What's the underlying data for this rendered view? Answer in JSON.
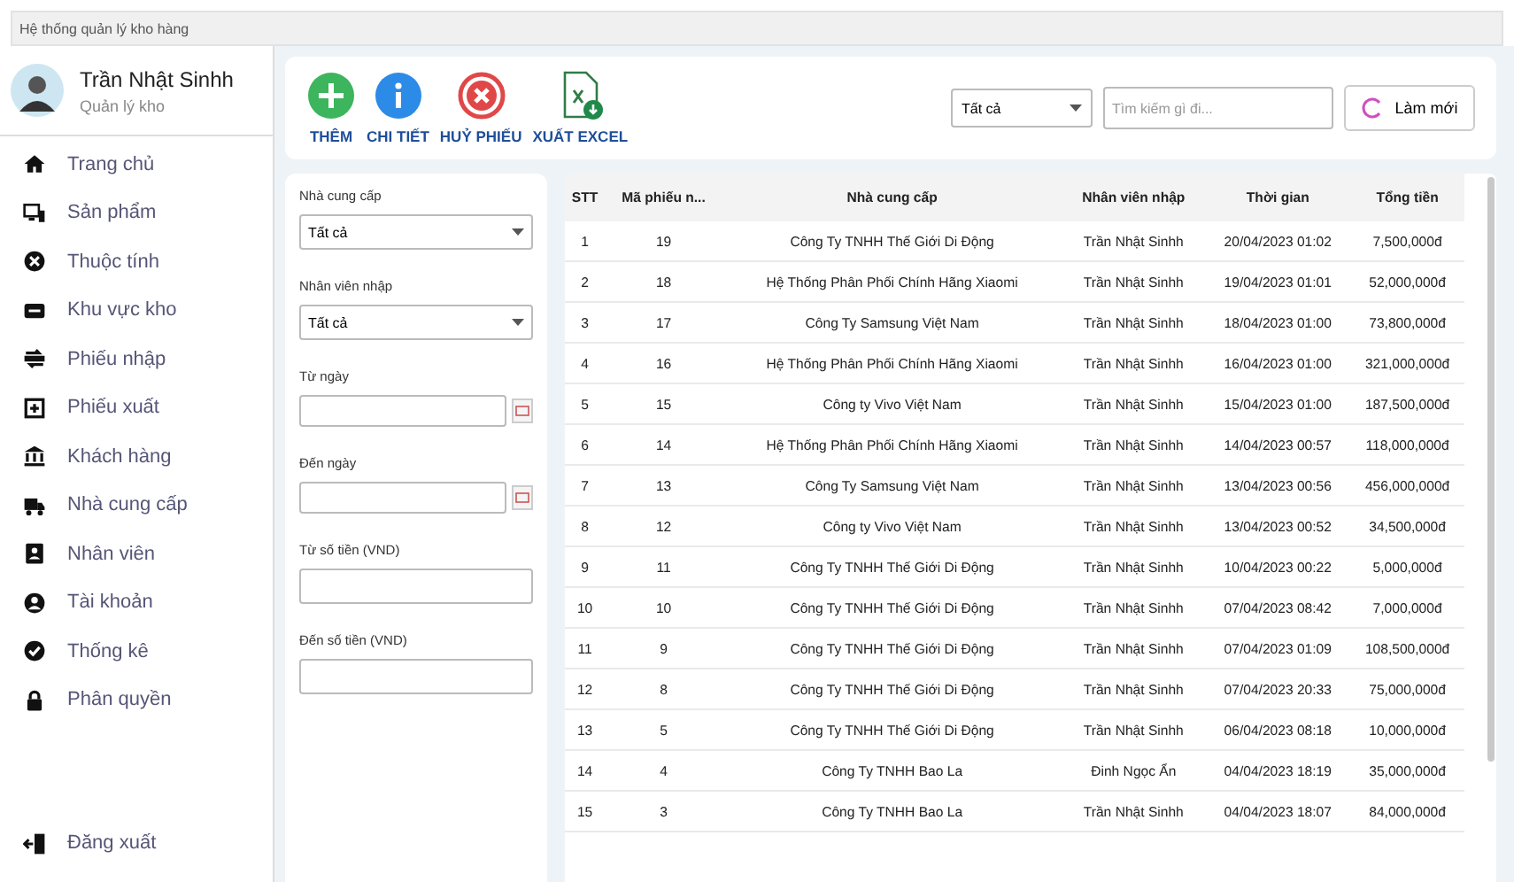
{
  "window": {
    "title": "Hệ thống quản lý kho hàng"
  },
  "user": {
    "name": "Trần Nhật Sinhh",
    "role": "Quản lý kho"
  },
  "sidebar": {
    "items": [
      {
        "label": "Trang chủ",
        "selected": false
      },
      {
        "label": "Sản phẩm",
        "selected": false
      },
      {
        "label": "Thuộc tính",
        "selected": false
      },
      {
        "label": "Khu vực kho",
        "selected": false
      },
      {
        "label": "Phiếu nhập",
        "selected": false
      },
      {
        "label": "Phiếu xuất",
        "selected": false
      },
      {
        "label": "Khách hàng",
        "selected": false
      },
      {
        "label": "Nhà cung cấp",
        "selected": false
      },
      {
        "label": "Nhân viên",
        "selected": false
      },
      {
        "label": "Tài khoản",
        "selected": false
      },
      {
        "label": "Thống kê",
        "selected": false
      },
      {
        "label": "Phân quyền",
        "selected": false
      }
    ],
    "logout": "Đăng xuất"
  },
  "toolbar": {
    "actions": [
      {
        "label": "THÊM",
        "kind": "add"
      },
      {
        "label": "CHI TIẾT",
        "kind": "info"
      },
      {
        "label": "HUỶ PHIẾU",
        "kind": "cancel"
      },
      {
        "label": "XUẤT EXCEL",
        "kind": "excel"
      }
    ],
    "filter_select": "Tất cả",
    "search": {
      "placeholder": "Tìm kiếm gì đi..."
    },
    "refresh": "Làm mới"
  },
  "filters": [
    {
      "label": "Nhà cung cấp",
      "kind": "select",
      "value": "Tất cả"
    },
    {
      "label": "Nhân viên nhập",
      "kind": "select",
      "value": "Tất cả"
    },
    {
      "label": "Từ ngày",
      "kind": "date"
    },
    {
      "label": "Đến ngày",
      "kind": "date"
    },
    {
      "label": "Từ số tiền (VND)",
      "kind": "text"
    },
    {
      "label": "Đến số tiền (VND)",
      "kind": "text"
    }
  ],
  "table": {
    "columns": [
      "STT",
      "Mã phiếu n...",
      "Nhà cung cấp",
      "Nhân viên nhập",
      "Thời gian",
      "Tổng tiền"
    ],
    "rows": [
      [
        "1",
        "19",
        "Công Ty TNHH Thế Giới Di Động",
        "Trần Nhật Sinhh",
        "20/04/2023 01:02",
        "7,500,000đ"
      ],
      [
        "2",
        "18",
        "Hệ Thống Phân Phối Chính Hãng Xiaomi",
        "Trần Nhật Sinhh",
        "19/04/2023 01:01",
        "52,000,000đ"
      ],
      [
        "3",
        "17",
        "Công Ty Samsung Việt Nam",
        "Trần Nhật Sinhh",
        "18/04/2023 01:00",
        "73,800,000đ"
      ],
      [
        "4",
        "16",
        "Hệ Thống Phân Phối Chính Hãng Xiaomi",
        "Trần Nhật Sinhh",
        "16/04/2023 01:00",
        "321,000,000đ"
      ],
      [
        "5",
        "15",
        "Công ty Vivo Việt Nam",
        "Trần Nhật Sinhh",
        "15/04/2023 01:00",
        "187,500,000đ"
      ],
      [
        "6",
        "14",
        "Hệ Thống Phân Phối Chính Hãng Xiaomi",
        "Trần Nhật Sinhh",
        "14/04/2023 00:57",
        "118,000,000đ"
      ],
      [
        "7",
        "13",
        "Công Ty Samsung Việt Nam",
        "Trần Nhật Sinhh",
        "13/04/2023 00:56",
        "456,000,000đ"
      ],
      [
        "8",
        "12",
        "Công ty Vivo Việt Nam",
        "Trần Nhật Sinhh",
        "13/04/2023 00:52",
        "34,500,000đ"
      ],
      [
        "9",
        "11",
        "Công Ty TNHH Thế Giới Di Động",
        "Trần Nhật Sinhh",
        "10/04/2023 00:22",
        "5,000,000đ"
      ],
      [
        "10",
        "10",
        "Công Ty TNHH Thế Giới Di Động",
        "Trần Nhật Sinhh",
        "07/04/2023 08:42",
        "7,000,000đ"
      ],
      [
        "11",
        "9",
        "Công Ty TNHH Thế Giới Di Động",
        "Trần Nhật Sinhh",
        "07/04/2023 01:09",
        "108,500,000đ"
      ],
      [
        "12",
        "8",
        "Công Ty TNHH Thế Giới Di Động",
        "Trần Nhật Sinhh",
        "07/04/2023 20:33",
        "75,000,000đ"
      ],
      [
        "13",
        "5",
        "Công Ty TNHH Thế Giới Di Động",
        "Trần Nhật Sinhh",
        "06/04/2023 08:18",
        "10,000,000đ"
      ],
      [
        "14",
        "4",
        "Công Ty TNHH Bao La",
        "Đinh Ngọc Ẩn",
        "04/04/2023 18:19",
        "35,000,000đ"
      ],
      [
        "15",
        "3",
        "Công Ty TNHH Bao La",
        "Trần Nhật Sinhh",
        "04/04/2023 18:07",
        "84,000,000đ"
      ]
    ]
  }
}
